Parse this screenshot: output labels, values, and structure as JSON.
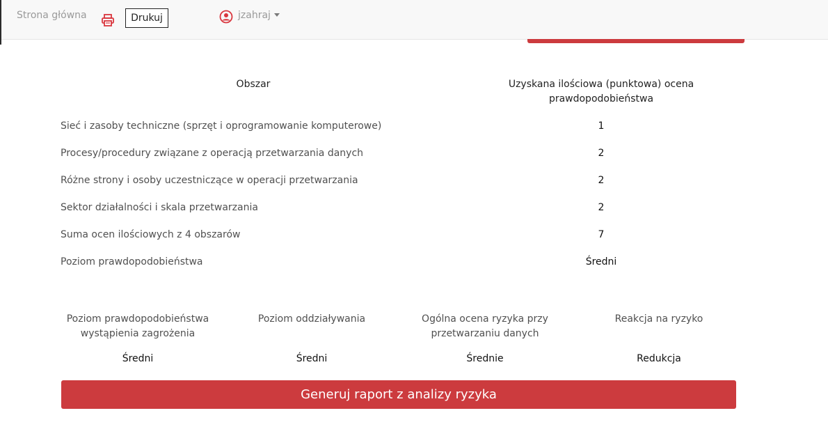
{
  "navbar": {
    "home_label": "Strona główna",
    "print_label": "Drukuj",
    "username": "jzahraj",
    "icons": [
      "printer-icon",
      "user-circle-icon",
      "caret-down-icon"
    ],
    "accent_color": "#cc3b3e"
  },
  "table": {
    "header_area": "Obszar",
    "header_score_line1": "Uzyskana ilościowa (punktowa) ocena",
    "header_score_line2": "prawdopodobieństwa",
    "rows": [
      {
        "label": "Sieć i zasoby techniczne (sprzęt i oprogramowanie komputerowe)",
        "value": "1"
      },
      {
        "label": "Procesy/procedury związane z operacją przetwarzania danych",
        "value": "2"
      },
      {
        "label": "Różne strony i osoby uczestniczące w operacji przetwarzania",
        "value": "2"
      },
      {
        "label": "Sektor działalności i skala przetwarzania",
        "value": "2"
      },
      {
        "label": "Suma ocen ilościowych z 4 obszarów",
        "value": "7"
      },
      {
        "label": "Poziom prawdopodobieństwa",
        "value": "Średni"
      }
    ]
  },
  "summary": {
    "items": [
      {
        "label_line1": "Poziom prawdopodobieństwa",
        "label_line2": "wystąpienia zagrożenia",
        "value": "Średni"
      },
      {
        "label_line1": "Poziom oddziaływania",
        "label_line2": "",
        "value": "Średni"
      },
      {
        "label_line1": "Ogólna ocena ryzyka przy",
        "label_line2": "przetwarzaniu danych",
        "value": "Średnie"
      },
      {
        "label_line1": "Reakcja na ryzyko",
        "label_line2": "",
        "value": "Redukcja"
      }
    ]
  },
  "generate_button_label": "Generuj raport z analizy ryzyka"
}
